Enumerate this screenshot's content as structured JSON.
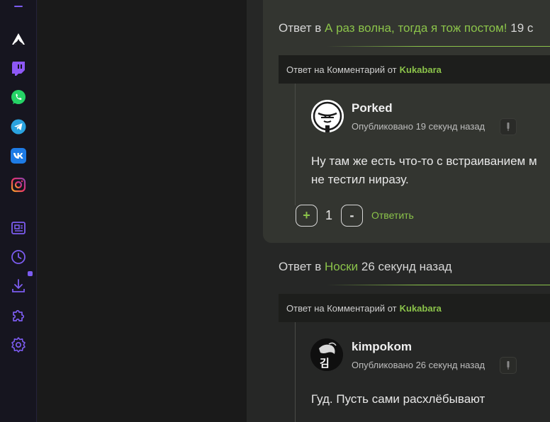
{
  "sidebar": {
    "icons": [
      {
        "name": "menu-icon",
        "color": "#7c5cf0"
      },
      {
        "name": "logo-icon",
        "color": "#ffffff"
      },
      {
        "name": "twitch-icon",
        "color": "#8e58f5"
      },
      {
        "name": "whatsapp-icon",
        "color": "#25d366"
      },
      {
        "name": "telegram-icon",
        "color": "#2aa3e0"
      },
      {
        "name": "vk-icon",
        "color": "#1e7be6"
      },
      {
        "name": "instagram-icon",
        "color": "#e8306b"
      },
      {
        "name": "news-icon",
        "color": "#7c5cf0"
      },
      {
        "name": "history-icon",
        "color": "#7c5cf0"
      },
      {
        "name": "download-icon",
        "color": "#7c5cf0"
      },
      {
        "name": "extensions-icon",
        "color": "#7c5cf0"
      },
      {
        "name": "settings-icon",
        "color": "#7c5cf0"
      }
    ]
  },
  "comments": [
    {
      "reply_prefix": "Ответ в",
      "thread_title": "А раз волна, тогда я тож постом!",
      "time_ago": " 19 с",
      "parent_label": "Ответ на Комментарий от",
      "parent_author": "Kukabara",
      "username": "Porked",
      "published": "Опубликовано 19 секунд назад",
      "text_line1": "Ну там же есть что-то с встраиванием м",
      "text_line2": "не тестил ниразу.",
      "vote_plus": "+",
      "score": "1",
      "vote_minus": "-",
      "reply_label": "Ответить"
    },
    {
      "reply_prefix": "Ответ в",
      "thread_title": "Носки",
      "time_ago": " 26 секунд назад",
      "parent_label": "Ответ на Комментарий от",
      "parent_author": "Kukabara",
      "username": "kimpokom",
      "published": "Опубликовано 26 секунд назад",
      "avatar_text": "김",
      "text_line1": "Гуд. Пусть сами расхлёбывают"
    }
  ],
  "colors": {
    "accent_green": "#8bc34a",
    "accent_purple": "#7c5cf0",
    "notification_dot": "#7c5cf0"
  }
}
